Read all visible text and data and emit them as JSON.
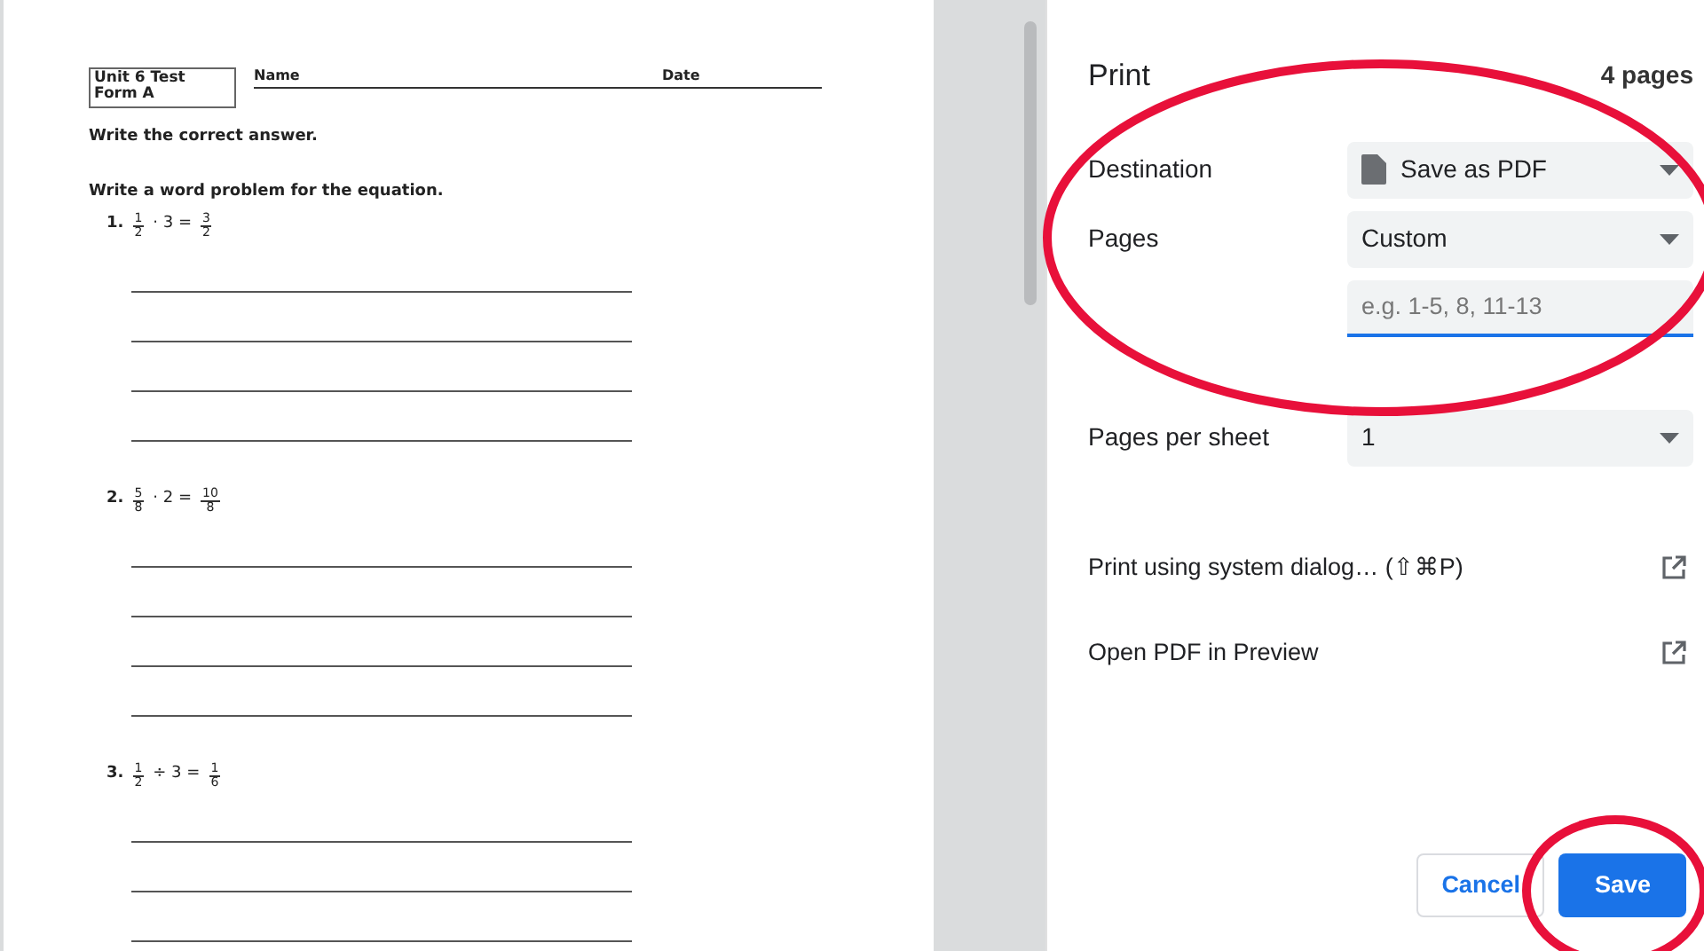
{
  "worksheet": {
    "title_lines": [
      "Unit 6 Test",
      "Form A"
    ],
    "name_label": "Name",
    "date_label": "Date",
    "instructions": [
      "Write the correct answer.",
      "Write a word problem for the equation."
    ],
    "problems": [
      {
        "number": "1.",
        "terms": [
          {
            "kind": "frac",
            "num": "1",
            "den": "2"
          },
          {
            "kind": "text",
            "text": "· 3 ="
          },
          {
            "kind": "frac",
            "num": "3",
            "den": "2"
          }
        ]
      },
      {
        "number": "2.",
        "terms": [
          {
            "kind": "frac",
            "num": "5",
            "den": "8"
          },
          {
            "kind": "text",
            "text": "· 2 ="
          },
          {
            "kind": "frac",
            "num": "10",
            "den": "8"
          }
        ]
      },
      {
        "number": "3.",
        "terms": [
          {
            "kind": "frac",
            "num": "1",
            "den": "2"
          },
          {
            "kind": "text",
            "text": "÷ 3 ="
          },
          {
            "kind": "frac",
            "num": "1",
            "den": "6"
          }
        ]
      }
    ]
  },
  "print_panel": {
    "title": "Print",
    "page_count": "4 pages",
    "settings": [
      {
        "kind": "select",
        "label": "Destination",
        "value": "Save as PDF",
        "icon": true
      },
      {
        "kind": "select",
        "label": "Pages",
        "value": "Custom",
        "icon": false
      },
      {
        "kind": "input",
        "placeholder": "e.g. 1-5, 8, 11-13"
      },
      {
        "kind": "select",
        "label": "Pages per sheet",
        "value": "1",
        "icon": false
      }
    ],
    "links": [
      "Print using system dialog… (⇧⌘P)",
      "Open PDF in Preview"
    ],
    "buttons": [
      {
        "kind": "secondary",
        "label": "Cancel"
      },
      {
        "kind": "primary",
        "label": "Save"
      }
    ]
  },
  "annotations": [
    {
      "kind": "ellipse",
      "color": "#e8103a"
    },
    {
      "kind": "ellipse",
      "color": "#e8103a"
    }
  ]
}
